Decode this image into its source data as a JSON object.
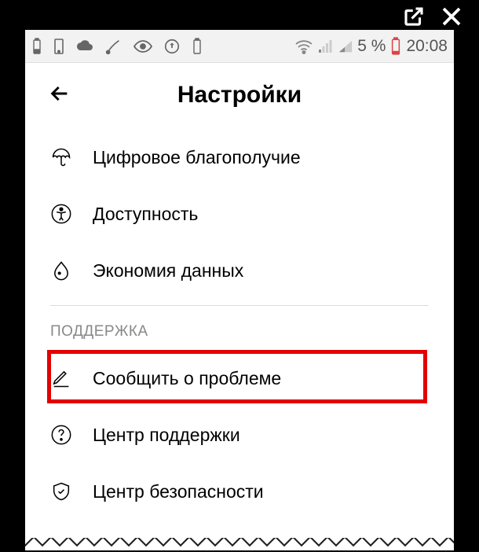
{
  "statusbar": {
    "battery_percent": "5 %",
    "time": "20:08"
  },
  "header": {
    "title": "Настройки"
  },
  "menu": {
    "items": [
      {
        "label": "Цифровое благополучие"
      },
      {
        "label": "Доступность"
      },
      {
        "label": "Экономия данных"
      }
    ]
  },
  "section": {
    "header": "ПОДДЕРЖКА",
    "items": [
      {
        "label": "Сообщить о проблеме"
      },
      {
        "label": "Центр поддержки"
      },
      {
        "label": "Центр безопасности"
      }
    ]
  },
  "highlight": {
    "color": "#e30000"
  }
}
